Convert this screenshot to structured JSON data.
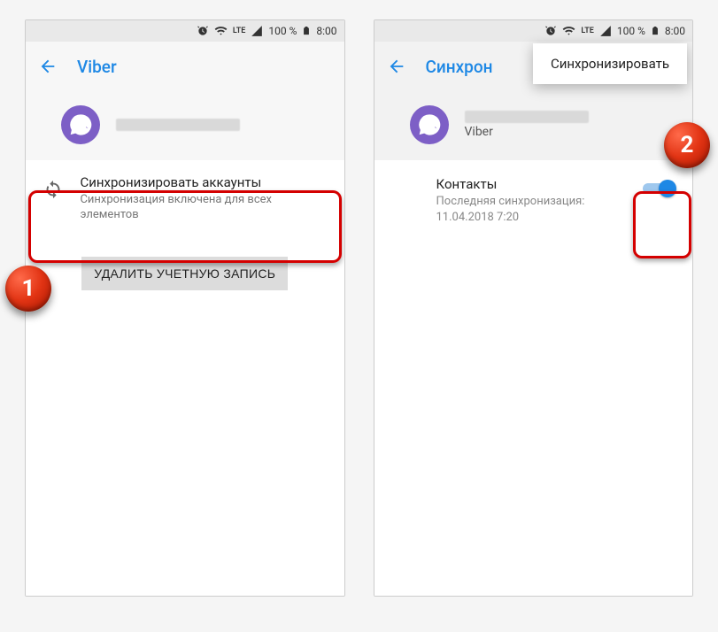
{
  "status": {
    "battery_text": "100 %",
    "time": "8:00",
    "lte": "LTE"
  },
  "left": {
    "title": "Viber",
    "sync_title": "Синхронизировать аккаунты",
    "sync_sub": "Синхронизация включена для всех элементов",
    "delete_label": "УДАЛИТЬ УЧЕТНУЮ ЗАПИСЬ"
  },
  "right": {
    "title": "Синхрон",
    "popup": "Синхронизировать",
    "account_sub": "Viber",
    "contacts_title": "Контакты",
    "contacts_sub": "Последняя синхронизация: 11.04.2018 7:20"
  },
  "markers": {
    "one": "1",
    "two": "2"
  }
}
